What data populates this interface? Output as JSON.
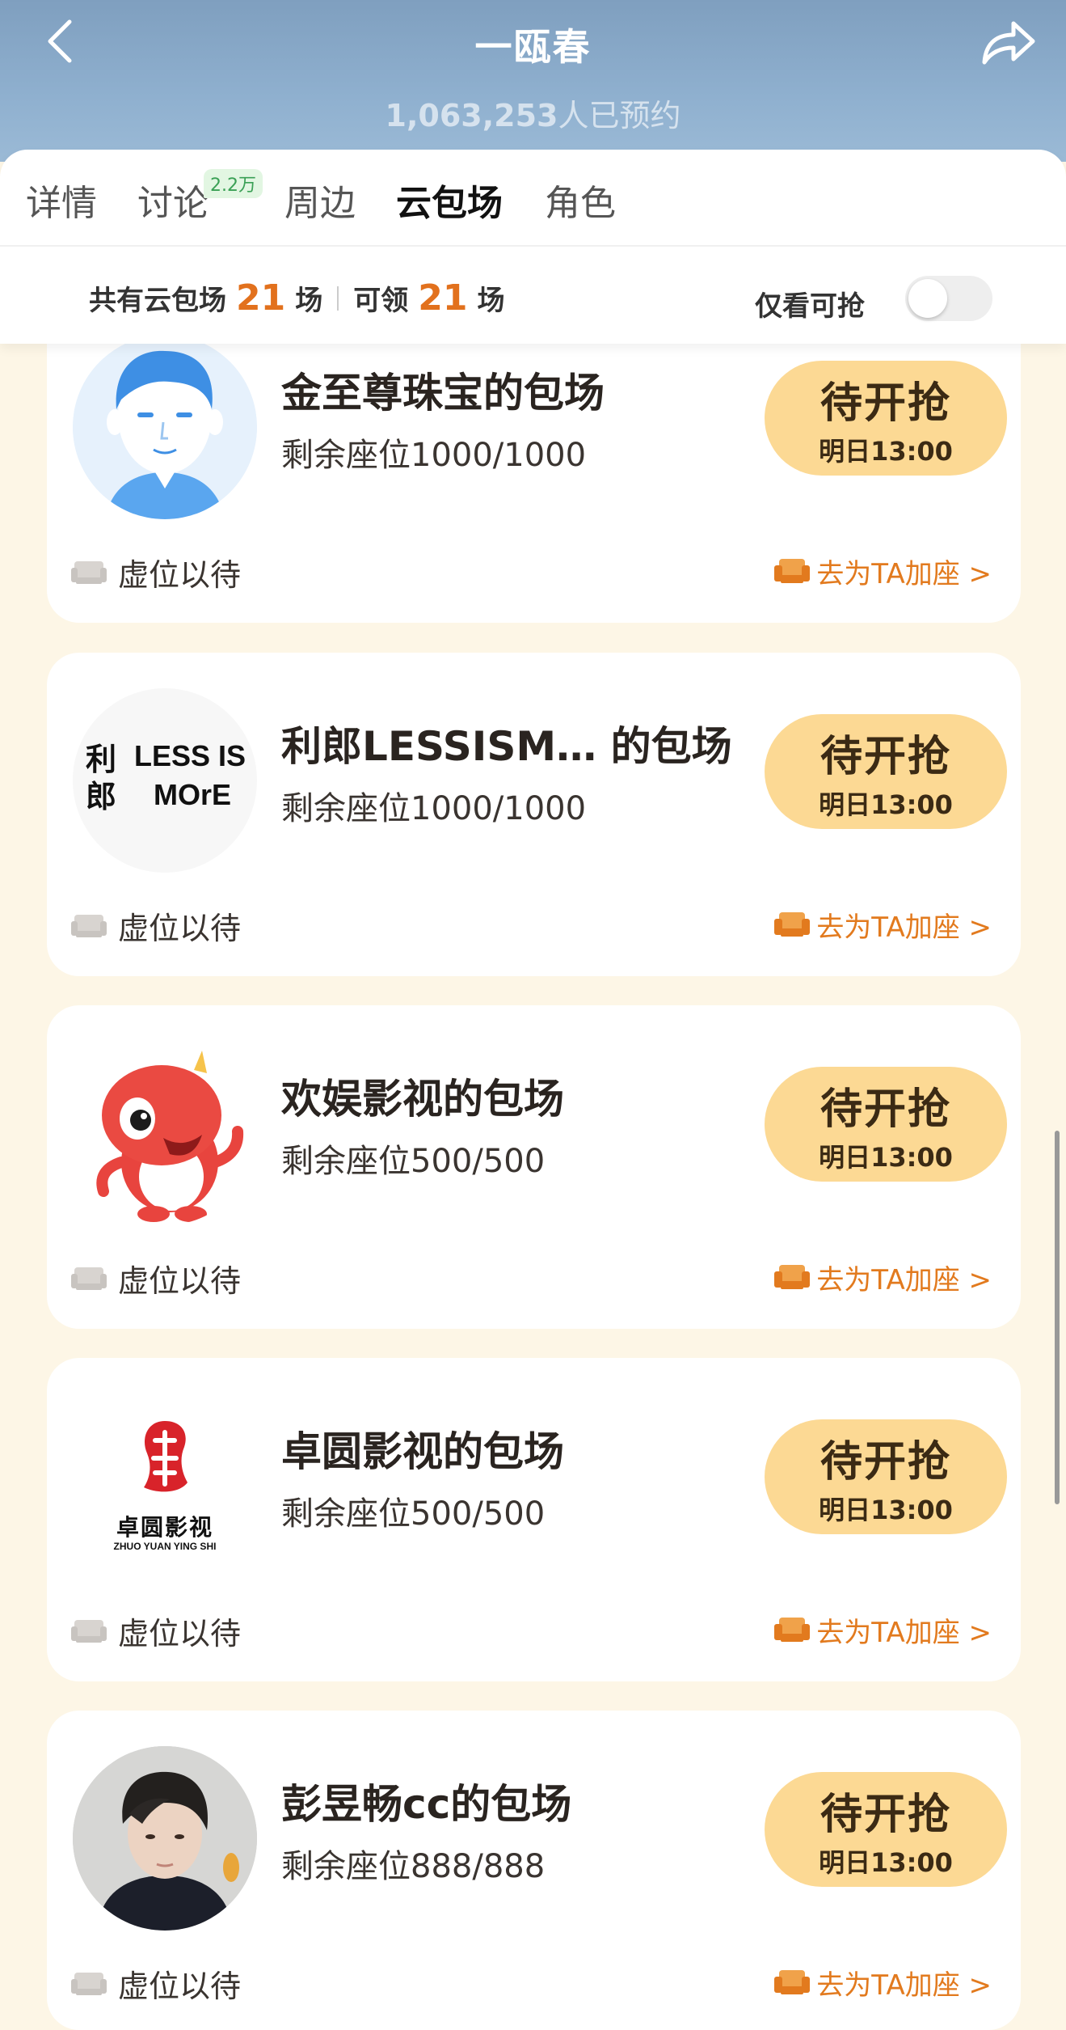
{
  "header": {
    "title": "一瓯春",
    "reservations_count": "1,063,253",
    "reservations_suffix": "人已预约"
  },
  "tabs": [
    {
      "label": "详情",
      "active": false
    },
    {
      "label": "讨论",
      "badge": "2.2万",
      "active": false
    },
    {
      "label": "周边",
      "active": false
    },
    {
      "label": "云包场",
      "active": true
    },
    {
      "label": "角色",
      "active": false
    }
  ],
  "summary": {
    "total_prefix": "共有云包场",
    "total_count": "21",
    "total_unit": "场",
    "available_prefix": "可领",
    "available_count": "21",
    "available_unit": "场",
    "toggle_label": "仅看可抢",
    "toggle_on": false
  },
  "colors": {
    "accent": "#e2711d",
    "button_bg": "#fcd994",
    "page_bg": "#fdf6e6"
  },
  "cards": [
    {
      "name": "金至尊珠宝的包场",
      "seats": "剩余座位1000/1000",
      "button_main": "待开抢",
      "button_sub": "明日13:00",
      "wait_label": "虚位以待",
      "link_label": "去为TA加座 >",
      "avatar": "cartoon-man-avatar"
    },
    {
      "name": "利郎LESSISM…  的包场",
      "seats": "剩余座位1000/1000",
      "button_main": "待开抢",
      "button_sub": "明日13:00",
      "wait_label": "虚位以待",
      "link_label": "去为TA加座 >",
      "avatar": "lessis-more-logo",
      "logo_cn": "利\n郎",
      "logo_en1": "LESS IS",
      "logo_en2": "MOrE"
    },
    {
      "name": "欢娱影视的包场",
      "seats": "剩余座位500/500",
      "button_main": "待开抢",
      "button_sub": "明日13:00",
      "wait_label": "虚位以待",
      "link_label": "去为TA加座 >",
      "avatar": "red-dragon-mascot"
    },
    {
      "name": "卓圆影视的包场",
      "seats": "剩余座位500/500",
      "button_main": "待开抢",
      "button_sub": "明日13:00",
      "wait_label": "虚位以待",
      "link_label": "去为TA加座 >",
      "avatar": "zhuo-yuan-logo",
      "logo_cn": "卓圆影视",
      "logo_en": "ZHUO YUAN YING SHI"
    },
    {
      "name": "彭昱畅cc的包场",
      "seats": "剩余座位888/888",
      "button_main": "待开抢",
      "button_sub": "明日13:00",
      "wait_label": "虚位以待",
      "link_label": "去为TA加座 >",
      "avatar": "person-photo"
    }
  ]
}
